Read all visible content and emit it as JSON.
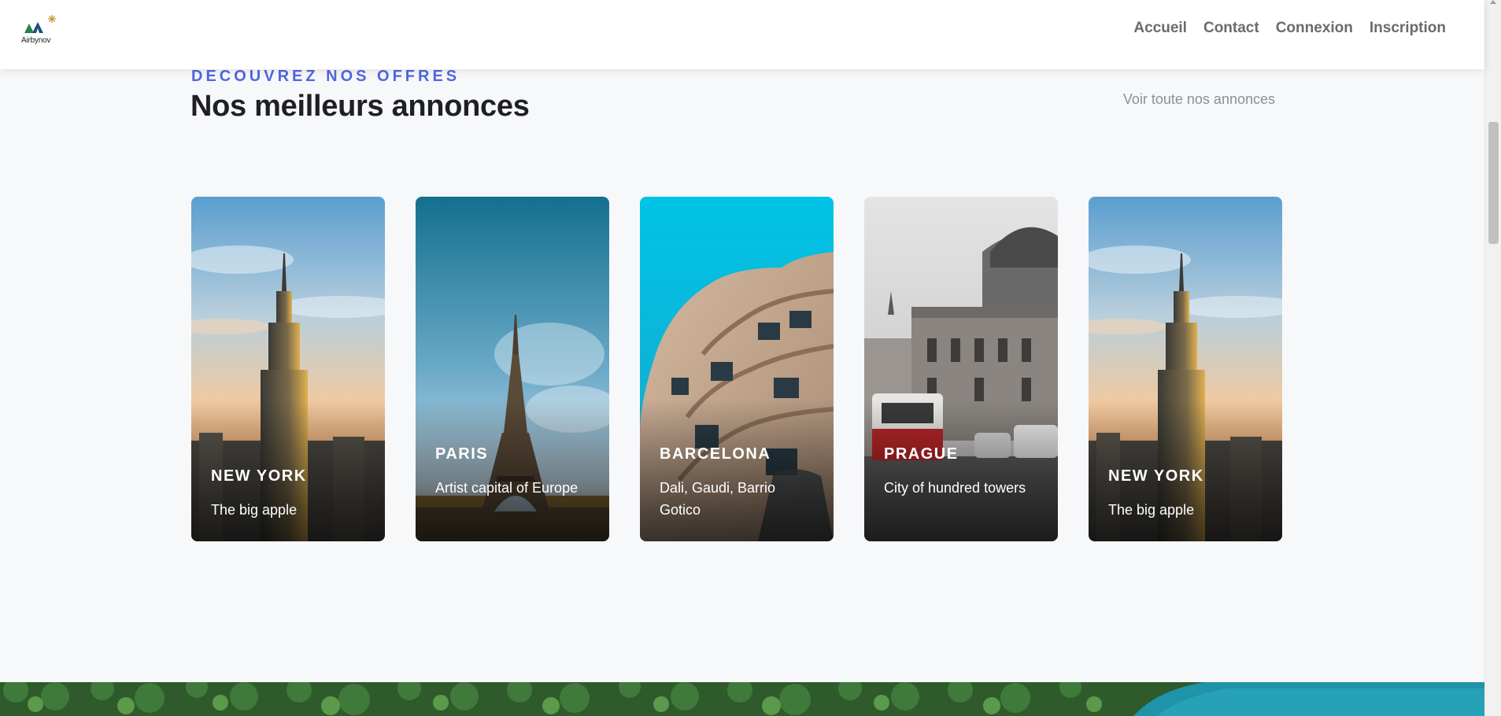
{
  "header": {
    "logo_text": "Airbynov",
    "nav": [
      {
        "label": "Accueil"
      },
      {
        "label": "Contact"
      },
      {
        "label": "Connexion"
      },
      {
        "label": "Inscription"
      }
    ]
  },
  "section": {
    "eyebrow": "DÉCOUVREZ NOS OFFRES",
    "title": "Nos meilleurs annonces",
    "see_all": "Voir toute nos annonces"
  },
  "cards": [
    {
      "city": "NEW YORK",
      "description": "The big apple",
      "photo": "empire-state-building"
    },
    {
      "city": "PARIS",
      "description": "Artist capital of Europe",
      "photo": "eiffel-tower"
    },
    {
      "city": "BARCELONA",
      "description": "Dali, Gaudi, Barrio Gotico",
      "photo": "casa-mila"
    },
    {
      "city": "PRAGUE",
      "description": "City of hundred towers",
      "photo": "tram-national-theatre"
    },
    {
      "city": "NEW YORK",
      "description": "The big apple",
      "photo": "empire-state-building"
    }
  ],
  "colors": {
    "accent": "#5266e0",
    "heading": "#1f1f27",
    "nav": "#6b6b6b",
    "muted": "#8a8f98",
    "background": "#f7f8fa"
  }
}
